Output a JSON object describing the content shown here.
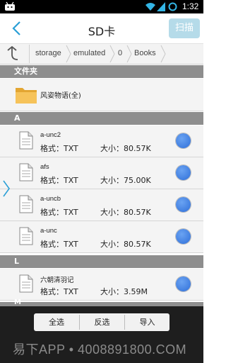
{
  "status_bar": {
    "time": "1:32",
    "icons": [
      "android-icon",
      "wifi-icon",
      "signal-icon",
      "battery-icon"
    ]
  },
  "header": {
    "title": "SD卡",
    "scan_label": "扫描"
  },
  "path": {
    "crumbs": [
      "storage",
      "emulated",
      "0",
      "Books"
    ]
  },
  "sections": {
    "folders": "文件夹",
    "a": "A",
    "l": "L",
    "m": "M"
  },
  "folders": [
    {
      "name": "风姿物语(全)"
    }
  ],
  "files": [
    {
      "name": "a-unc2",
      "format": "格式：TXT",
      "size": "大小：80.57K"
    },
    {
      "name": "afs",
      "format": "格式：TXT",
      "size": "大小：75.00K"
    },
    {
      "name": "a-uncb",
      "format": "格式：TXT",
      "size": "大小：80.57K"
    },
    {
      "name": "a-unc",
      "format": "格式：TXT",
      "size": "大小：80.57K"
    },
    {
      "name": "六朝清羽记",
      "format": "格式：TXT",
      "size": "大小：3.59M"
    }
  ],
  "actions": {
    "select_all": "全选",
    "invert": "反选",
    "import": "导入"
  },
  "watermark": "易下APP • 4008891800.COM",
  "colors": {
    "accent": "#2a9fd6",
    "scan_button": "#b5dbe9",
    "section": "#8e8e8e",
    "radio": "#2f6fd9"
  }
}
